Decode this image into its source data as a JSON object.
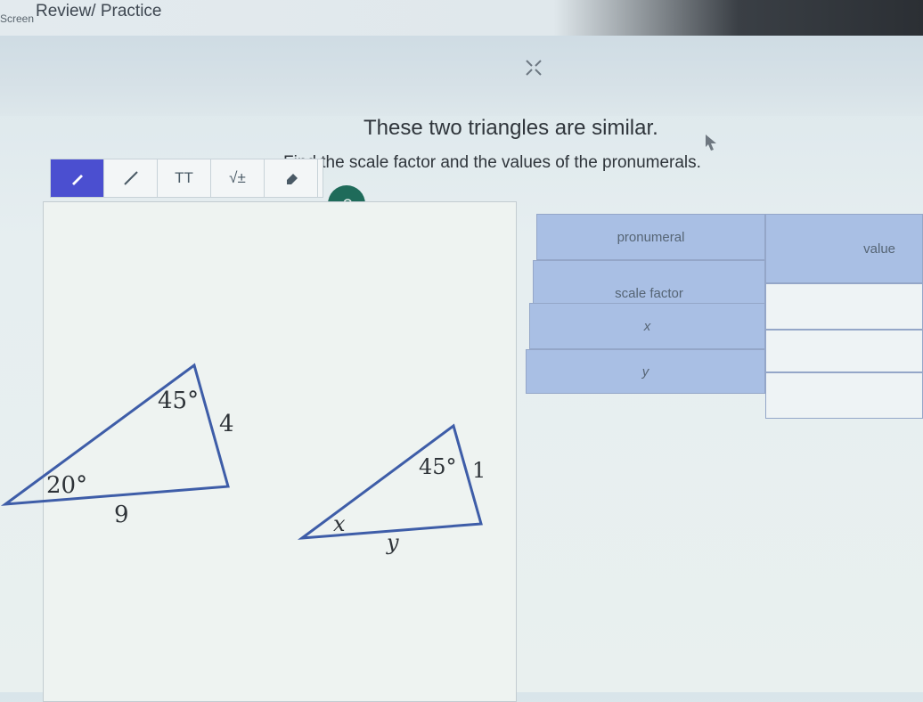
{
  "header": {
    "breadcrumb": "Review/ Practice",
    "screen_label": "Screen"
  },
  "question": {
    "title": "These two triangles are similar.",
    "instruction": "Find the scale factor and the values of the pronumerals."
  },
  "toolbar": {
    "tools": [
      "pen",
      "line",
      "text",
      "math",
      "eraser"
    ],
    "text_label": "TT",
    "math_label": "√±"
  },
  "controls": {
    "undo_icon": "undo-icon",
    "close_icon": "close-icon"
  },
  "figure": {
    "triangle_large": {
      "angle_a": "45°",
      "angle_b": "20°",
      "side_right": "4",
      "side_bottom": "9"
    },
    "triangle_small": {
      "angle_a": "45°",
      "side_right": "1",
      "angle_x": "x",
      "side_bottom": "y"
    }
  },
  "table": {
    "headers": [
      "pronumeral",
      "value"
    ],
    "rows": [
      {
        "name": "scale factor",
        "value": ""
      },
      {
        "name": "x",
        "value": ""
      },
      {
        "name": "y",
        "value": ""
      }
    ]
  }
}
